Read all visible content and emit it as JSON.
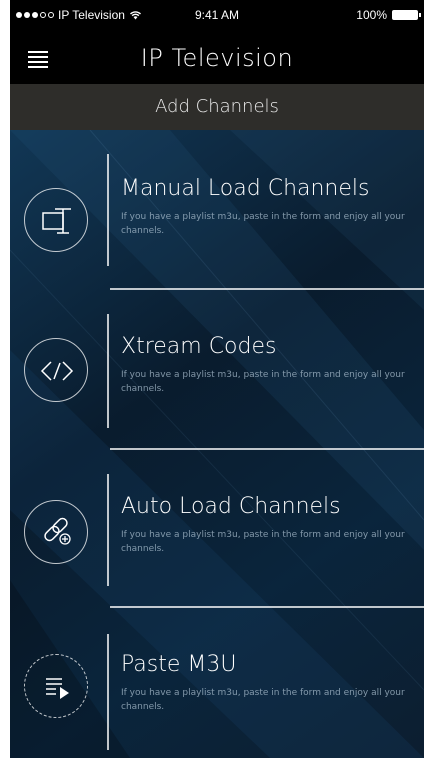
{
  "status_bar": {
    "carrier": "IP Television",
    "time": "9:41 AM",
    "battery": "100%"
  },
  "nav": {
    "title": "IP Television"
  },
  "section": {
    "title": "Add Channels"
  },
  "items": [
    {
      "title": "Manual Load Channels",
      "description": "If you have a playlist m3u, paste in the form and enjoy all your channels.",
      "icon": "monitor-input-icon"
    },
    {
      "title": "Xtream Codes",
      "description": "If you have a playlist m3u, paste in the form and enjoy all your channels.",
      "icon": "code-icon"
    },
    {
      "title": "Auto Load Channels",
      "description": "If you have a playlist m3u, paste in the form and enjoy all your channels.",
      "icon": "link-add-icon"
    },
    {
      "title": "Paste M3U",
      "description": "If you have a playlist m3u, paste in the form and enjoy all your channels.",
      "icon": "playlist-play-icon"
    }
  ]
}
